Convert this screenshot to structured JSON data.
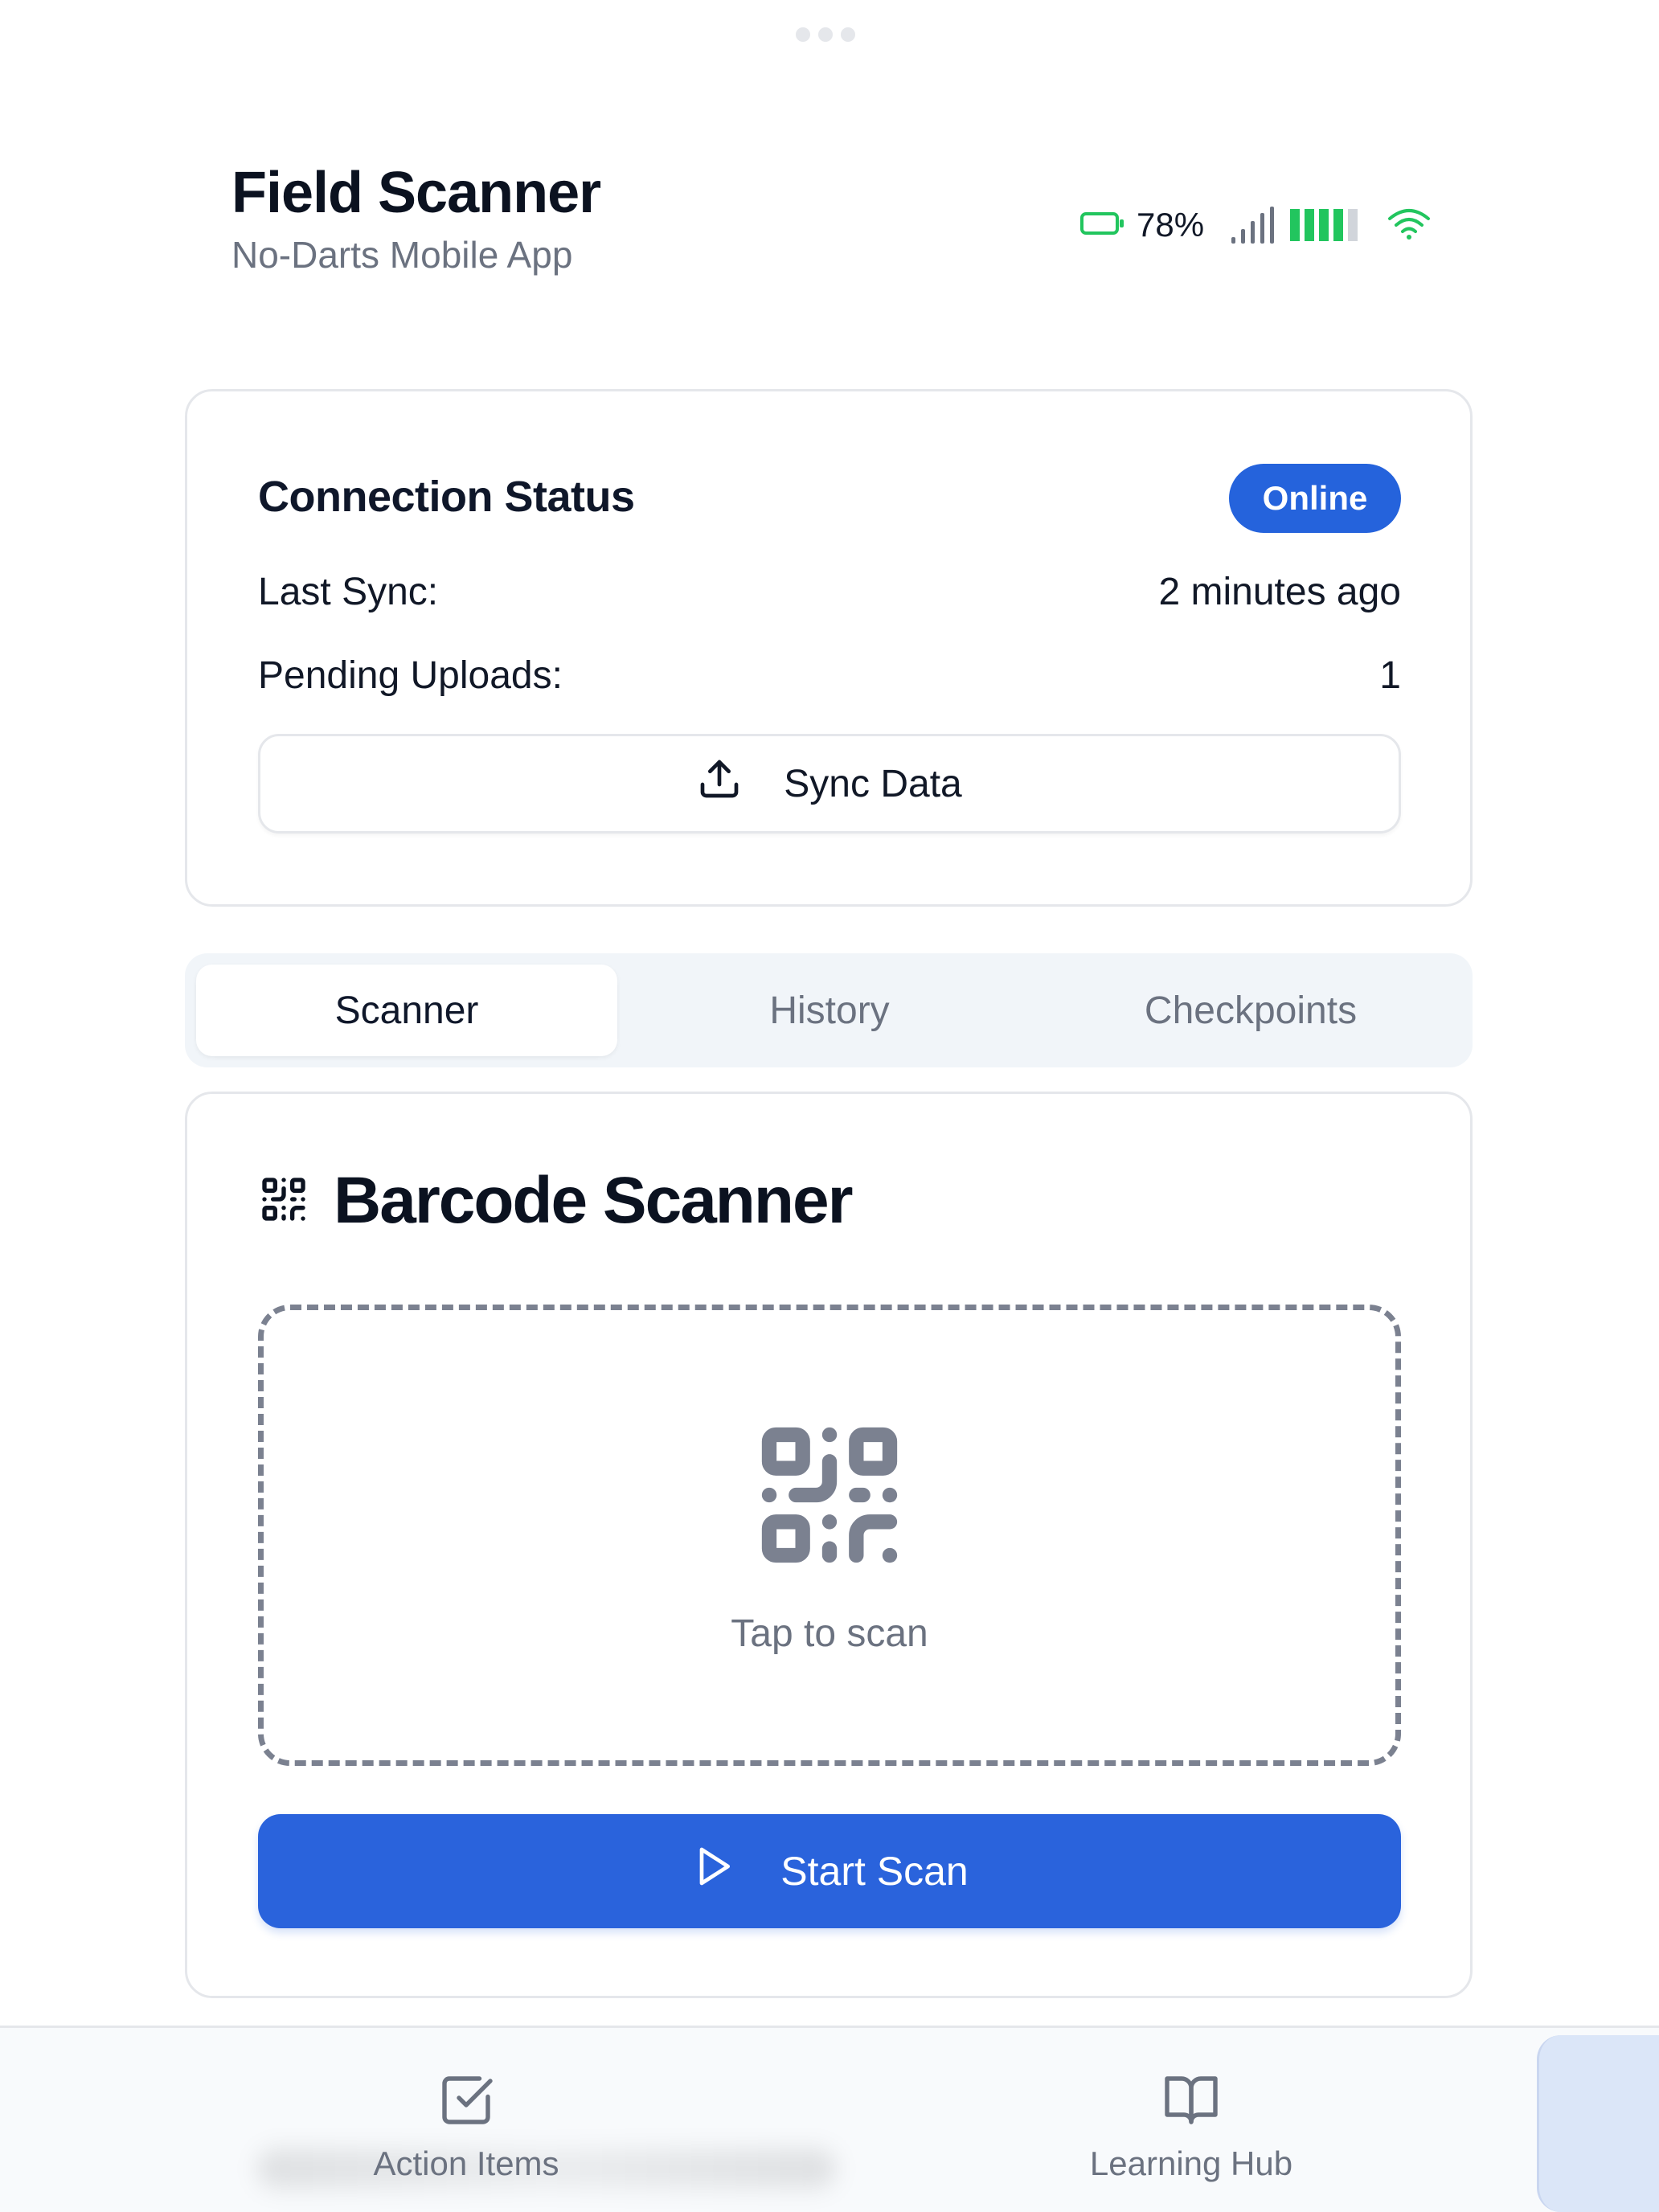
{
  "app": {
    "title": "Field Scanner",
    "subtitle": "No-Darts Mobile App"
  },
  "status_bar": {
    "battery_percent": "78%",
    "battery_icon": "battery-icon",
    "signal_icon": "signal-bars-icon",
    "wifi_icon": "wifi-icon",
    "colors": {
      "good": "#22c55e",
      "muted": "#d1d5db"
    }
  },
  "connection": {
    "title": "Connection Status",
    "status_badge": "Online",
    "last_sync_label": "Last Sync:",
    "last_sync_value": "2 minutes ago",
    "pending_label": "Pending Uploads:",
    "pending_value": "1",
    "sync_button": "Sync Data",
    "sync_icon": "upload-icon"
  },
  "tabs": [
    {
      "label": "Scanner",
      "active": true
    },
    {
      "label": "History",
      "active": false
    },
    {
      "label": "Checkpoints",
      "active": false
    }
  ],
  "scanner": {
    "title": "Barcode Scanner",
    "title_icon": "qr-code-icon",
    "hint": "Tap to scan",
    "start_button": "Start Scan",
    "start_icon": "play-icon"
  },
  "bottom_nav": [
    {
      "label": "Action Items",
      "icon": "checkbox-icon"
    },
    {
      "label": "Learning Hub",
      "icon": "book-icon"
    }
  ],
  "colors": {
    "accent": "#2563dc",
    "text": "#0f172a",
    "muted_text": "#6b7280",
    "border": "#e5e7eb"
  }
}
